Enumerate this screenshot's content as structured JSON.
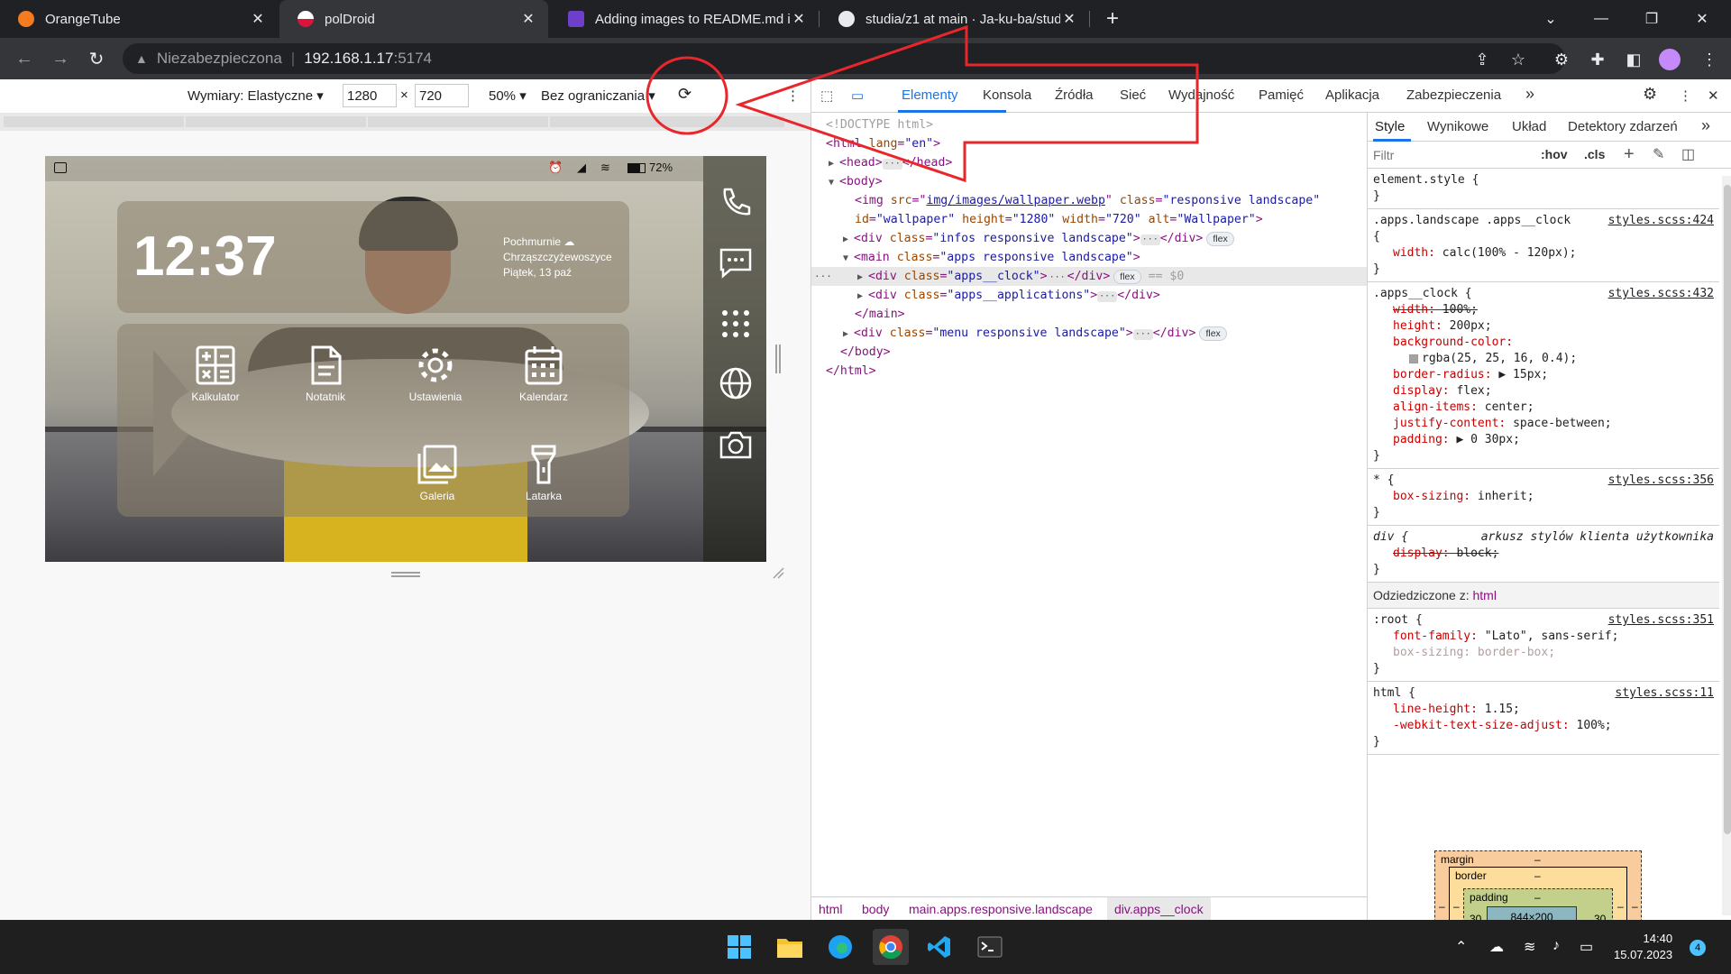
{
  "browser": {
    "tabs": [
      {
        "title": "OrangeTube",
        "favicon_color": "#f47b20",
        "active": false
      },
      {
        "title": "polDroid",
        "favicon_color": "#e8eaed",
        "active": true
      },
      {
        "title": "Adding images to README.md in",
        "favicon_color": "#6e40c9",
        "active": false
      },
      {
        "title": "studia/z1 at main · Ja-ku-ba/stud",
        "favicon_color": "#e8eaed",
        "active": false
      }
    ],
    "new_tab_label": "+",
    "address": {
      "security_label": "Niezabezpieczona",
      "host": "192.168.1.17",
      "port": ":5174"
    }
  },
  "device_toolbar": {
    "dimensions_label": "Wymiary: Elastyczne",
    "width_value": "1280",
    "times": "×",
    "height_value": "720",
    "zoom": "50%",
    "throttling": "Bez ograniczania",
    "more": "⋮"
  },
  "phone": {
    "statusbar": {
      "battery": "72%"
    },
    "clock": {
      "time": "12:37"
    },
    "weather": {
      "condition": "Pochmurnie",
      "location": "Chrząszczyżewoszyce",
      "date": "Piątek, 13 paź"
    },
    "apps": [
      {
        "label": "Kalkulator",
        "icon": "calculator-icon"
      },
      {
        "label": "Notatnik",
        "icon": "notepad-icon"
      },
      {
        "label": "Ustawienia",
        "icon": "settings-icon"
      },
      {
        "label": "Kalendarz",
        "icon": "calendar-icon"
      },
      {
        "label": "Galeria",
        "icon": "gallery-icon"
      },
      {
        "label": "Latarka",
        "icon": "flashlight-icon"
      }
    ],
    "menu_icons": [
      "phone-icon",
      "message-icon",
      "apps-grid-icon",
      "globe-icon",
      "camera-icon"
    ]
  },
  "devtools": {
    "tabs": [
      "Elementy",
      "Konsola",
      "Źródła",
      "Sieć",
      "Wydajność",
      "Pamięć",
      "Aplikacja",
      "Zabezpieczenia"
    ],
    "more_tabs": "»",
    "active_tab": "Elementy",
    "dom_lines": [
      {
        "indent": 0,
        "parts": [
          [
            "cm",
            "<!DOCTYPE html>"
          ]
        ]
      },
      {
        "indent": 0,
        "parts": [
          [
            "tag",
            "<html "
          ],
          [
            "at",
            "lang"
          ],
          [
            "tag",
            "="
          ],
          [
            "av",
            "\"en\""
          ],
          [
            "tag",
            ">"
          ]
        ]
      },
      {
        "indent": 1,
        "arrow": "▶",
        "parts": [
          [
            "tag",
            "<head>"
          ],
          [
            "dots",
            "···"
          ],
          [
            "tag",
            "</head>"
          ]
        ]
      },
      {
        "indent": 1,
        "arrow": "▼",
        "parts": [
          [
            "tag",
            "<body>"
          ]
        ]
      },
      {
        "indent": 2,
        "parts": [
          [
            "tag",
            "<img "
          ],
          [
            "at",
            "src"
          ],
          [
            "tag",
            "=\""
          ],
          [
            "link",
            "img/images/wallpaper.webp"
          ],
          [
            "tag",
            "\" "
          ],
          [
            "at",
            "class"
          ],
          [
            "tag",
            "="
          ],
          [
            "av",
            "\"responsive landscape\""
          ]
        ]
      },
      {
        "indent": 2,
        "parts": [
          [
            "at",
            "id"
          ],
          [
            "tag",
            "="
          ],
          [
            "av",
            "\"wallpaper\" "
          ],
          [
            "at",
            "height"
          ],
          [
            "tag",
            "="
          ],
          [
            "av",
            "\"1280\" "
          ],
          [
            "at",
            "width"
          ],
          [
            "tag",
            "="
          ],
          [
            "av",
            "\"720\" "
          ],
          [
            "at",
            "alt"
          ],
          [
            "tag",
            "="
          ],
          [
            "av",
            "\"Wallpaper\""
          ],
          [
            "tag",
            ">"
          ]
        ]
      },
      {
        "indent": 2,
        "arrow": "▶",
        "parts": [
          [
            "tag",
            "<div "
          ],
          [
            "at",
            "class"
          ],
          [
            "tag",
            "="
          ],
          [
            "av",
            "\"infos responsive landscape\""
          ],
          [
            "tag",
            ">"
          ],
          [
            "dots",
            "···"
          ],
          [
            "tag",
            "</div>"
          ],
          [
            "pill",
            "flex"
          ]
        ]
      },
      {
        "indent": 2,
        "arrow": "▼",
        "parts": [
          [
            "tag",
            "<main "
          ],
          [
            "at",
            "class"
          ],
          [
            "tag",
            "="
          ],
          [
            "av",
            "\"apps responsive landscape\""
          ],
          [
            "tag",
            ">"
          ]
        ]
      },
      {
        "indent": 3,
        "arrow": "▶",
        "selected": true,
        "parts": [
          [
            "tag",
            "<div "
          ],
          [
            "at",
            "class"
          ],
          [
            "tag",
            "="
          ],
          [
            "av",
            "\"apps__clock\""
          ],
          [
            "tag",
            ">"
          ],
          [
            "dots",
            "···"
          ],
          [
            "tag",
            "</div>"
          ],
          [
            "pill",
            "flex"
          ],
          [
            "cm",
            " == $0"
          ]
        ]
      },
      {
        "indent": 3,
        "arrow": "▶",
        "parts": [
          [
            "tag",
            "<div "
          ],
          [
            "at",
            "class"
          ],
          [
            "tag",
            "="
          ],
          [
            "av",
            "\"apps__applications\""
          ],
          [
            "tag",
            ">"
          ],
          [
            "dots",
            "···"
          ],
          [
            "tag",
            "</div>"
          ]
        ]
      },
      {
        "indent": 2,
        "parts": [
          [
            "tag",
            "</main>"
          ]
        ]
      },
      {
        "indent": 2,
        "arrow": "▶",
        "parts": [
          [
            "tag",
            "<div "
          ],
          [
            "at",
            "class"
          ],
          [
            "tag",
            "="
          ],
          [
            "av",
            "\"menu responsive landscape\""
          ],
          [
            "tag",
            ">"
          ],
          [
            "dots",
            "···"
          ],
          [
            "tag",
            "</div>"
          ],
          [
            "pill",
            "flex"
          ]
        ]
      },
      {
        "indent": 1,
        "parts": [
          [
            "tag",
            "</body>"
          ]
        ]
      },
      {
        "indent": 0,
        "parts": [
          [
            "tag",
            "</html>"
          ]
        ]
      }
    ],
    "breadcrumbs": [
      "html",
      "body",
      "main.apps.responsive.landscape",
      "div.apps__clock"
    ],
    "styles_tabs": [
      "Style",
      "Wynikowe",
      "Układ",
      "Detektory zdarzeń"
    ],
    "filter_placeholder": "Filtr",
    "hov": ":hov",
    "cls": ".cls",
    "rules": [
      {
        "selector": "element.style {",
        "source": "",
        "props": [],
        "close": "}"
      },
      {
        "selector": ".apps.landscape .apps__clock",
        "source": "styles.scss:424",
        "open": "{",
        "props": [
          {
            "name": "width",
            "value": "calc(100% - 120px);"
          }
        ],
        "close": "}"
      },
      {
        "selector": ".apps__clock {",
        "source": "styles.scss:432",
        "props": [
          {
            "name": "width",
            "value": "100%;",
            "strike": true
          },
          {
            "name": "height",
            "value": "200px;"
          },
          {
            "name": "background-color",
            "value": ""
          },
          {
            "name": "",
            "value": "rgba(25, 25, 16, 0.4);",
            "swatch": true
          },
          {
            "name": "border-radius",
            "value": "▶ 15px;"
          },
          {
            "name": "display",
            "value": "flex;"
          },
          {
            "name": "align-items",
            "value": "center;"
          },
          {
            "name": "justify-content",
            "value": "space-between;"
          },
          {
            "name": "padding",
            "value": "▶ 0 30px;"
          }
        ],
        "close": "}"
      },
      {
        "selector": "* {",
        "source": "styles.scss:356",
        "props": [
          {
            "name": "box-sizing",
            "value": "inherit;"
          }
        ],
        "close": "}"
      },
      {
        "selector": "div {",
        "source": "arkusz stylów klienta użytkownika",
        "source_italic": true,
        "props": [
          {
            "name": "display",
            "value": "block;",
            "strike": true
          }
        ],
        "close": "}"
      }
    ],
    "inherited_label": "Odziedziczone z:",
    "inherited_from": "html",
    "rules2": [
      {
        "selector": ":root {",
        "source": "styles.scss:351",
        "props": [
          {
            "name": "font-family",
            "value": "\"Lato\", sans-serif;"
          },
          {
            "name": "box-sizing",
            "value": "border-box;",
            "faded": true
          }
        ],
        "close": "}"
      },
      {
        "selector": "html {",
        "source": "styles.scss:11",
        "props": [
          {
            "name": "line-height",
            "value": "1.15;"
          },
          {
            "name": "-webkit-text-size-adjust",
            "value": "100%;"
          }
        ],
        "close": "}"
      }
    ],
    "box_model": {
      "margin_label": "margin",
      "border_label": "border",
      "padding_label": "padding",
      "dash": "–",
      "padding_left": "30",
      "padding_right": "30",
      "content": "844×200"
    }
  },
  "taskbar": {
    "time": "14:40",
    "date": "15.07.2023",
    "notifications": "4"
  },
  "annotation_color": "#e8262b"
}
